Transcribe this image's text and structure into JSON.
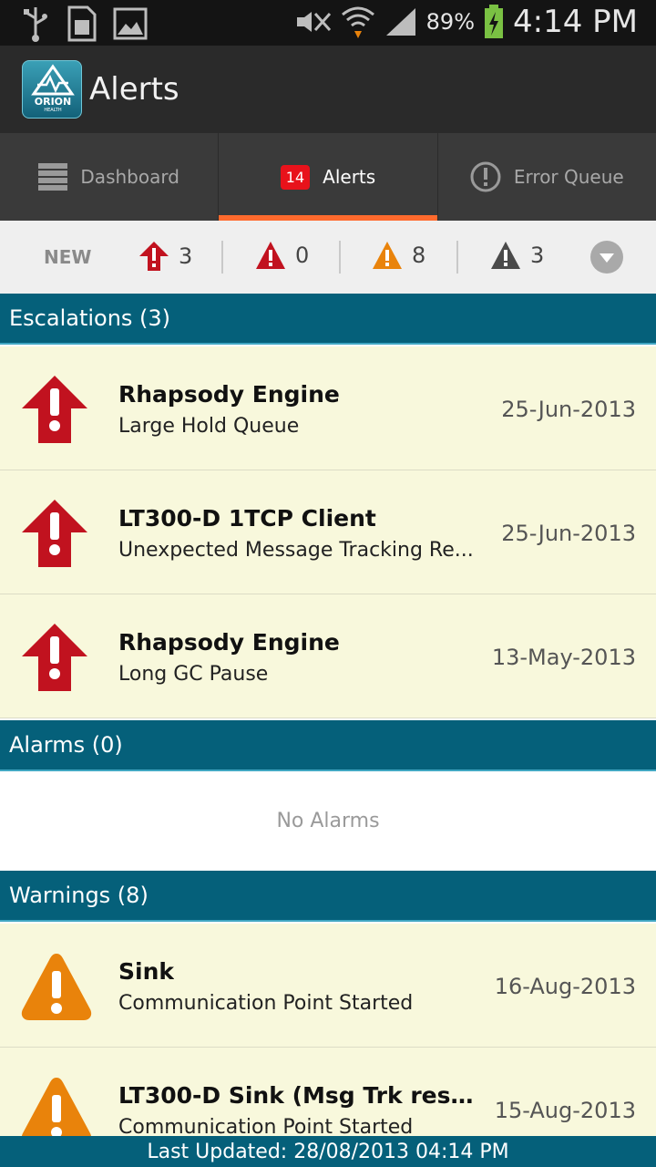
{
  "status_bar": {
    "battery_pct": "89%",
    "time": "4:14 PM",
    "icons": [
      "usb-icon",
      "sim-card-icon",
      "gallery-icon",
      "mute-icon",
      "wifi-icon",
      "signal-icon",
      "battery-icon"
    ]
  },
  "app": {
    "title": "Alerts",
    "logo_text": "ORION",
    "logo_sub": "HEALTH"
  },
  "tabs": [
    {
      "label": "Dashboard",
      "icon": "dashboard-icon",
      "active": false
    },
    {
      "label": "Alerts",
      "badge": "14",
      "active": true
    },
    {
      "label": "Error Queue",
      "icon": "error-circle-icon",
      "active": false
    }
  ],
  "filter": {
    "new_label": "NEW",
    "counts": [
      {
        "type": "escalation",
        "value": "3",
        "color": "#c1121f"
      },
      {
        "type": "alarm",
        "value": "0",
        "color": "#c1121f"
      },
      {
        "type": "warning",
        "value": "8",
        "color": "#e9830b"
      },
      {
        "type": "info",
        "value": "3",
        "color": "#4a4a4a"
      }
    ]
  },
  "sections": {
    "escalations": {
      "title": "Escalations (3)",
      "items": [
        {
          "title": "Rhapsody Engine",
          "subtitle": "Large Hold Queue",
          "date": "25-Jun-2013"
        },
        {
          "title": "LT300-D 1TCP Client",
          "subtitle": "Unexpected Message Tracking Re...",
          "date": "25-Jun-2013"
        },
        {
          "title": "Rhapsody Engine",
          "subtitle": "Long GC Pause",
          "date": "13-May-2013"
        }
      ]
    },
    "alarms": {
      "title": "Alarms (0)",
      "empty": "No Alarms"
    },
    "warnings": {
      "title": "Warnings (8)",
      "items": [
        {
          "title": "Sink",
          "subtitle": "Communication Point Started",
          "date": "16-Aug-2013"
        },
        {
          "title": "LT300-D Sink (Msg Trk respon...",
          "subtitle": "Communication Point Started",
          "date": "15-Aug-2013"
        }
      ]
    }
  },
  "footer": {
    "last_updated": "Last Updated: 28/08/2013 04:14 PM"
  },
  "colors": {
    "accent": "#ff6a2d",
    "section_header": "#05607a",
    "row_bg": "#f8f8dc",
    "escalation_red": "#c1121f",
    "warning_orange": "#e9830b"
  }
}
